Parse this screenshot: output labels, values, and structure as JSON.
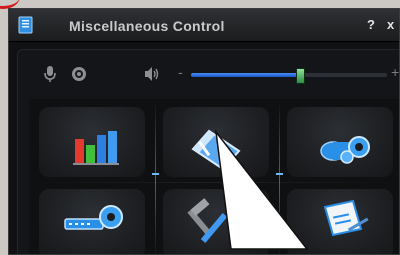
{
  "window": {
    "title": "Miscellaneous Control",
    "help_label": "?",
    "close_label": "x"
  },
  "toolbar": {
    "volume": {
      "minus_label": "-",
      "plus_label": "+",
      "level": 0.55
    }
  },
  "tiles": [
    {
      "icon": "bar-chart-icon"
    },
    {
      "icon": "eraser-icon"
    },
    {
      "icon": "camera-settings-icon"
    },
    {
      "icon": "network-settings-icon"
    },
    {
      "icon": "tools-icon"
    },
    {
      "icon": "notepad-icon"
    }
  ],
  "colors": {
    "accent": "#2a7fd4",
    "title_text": "#c9cacc",
    "annotation_red": "#d21a1a"
  }
}
